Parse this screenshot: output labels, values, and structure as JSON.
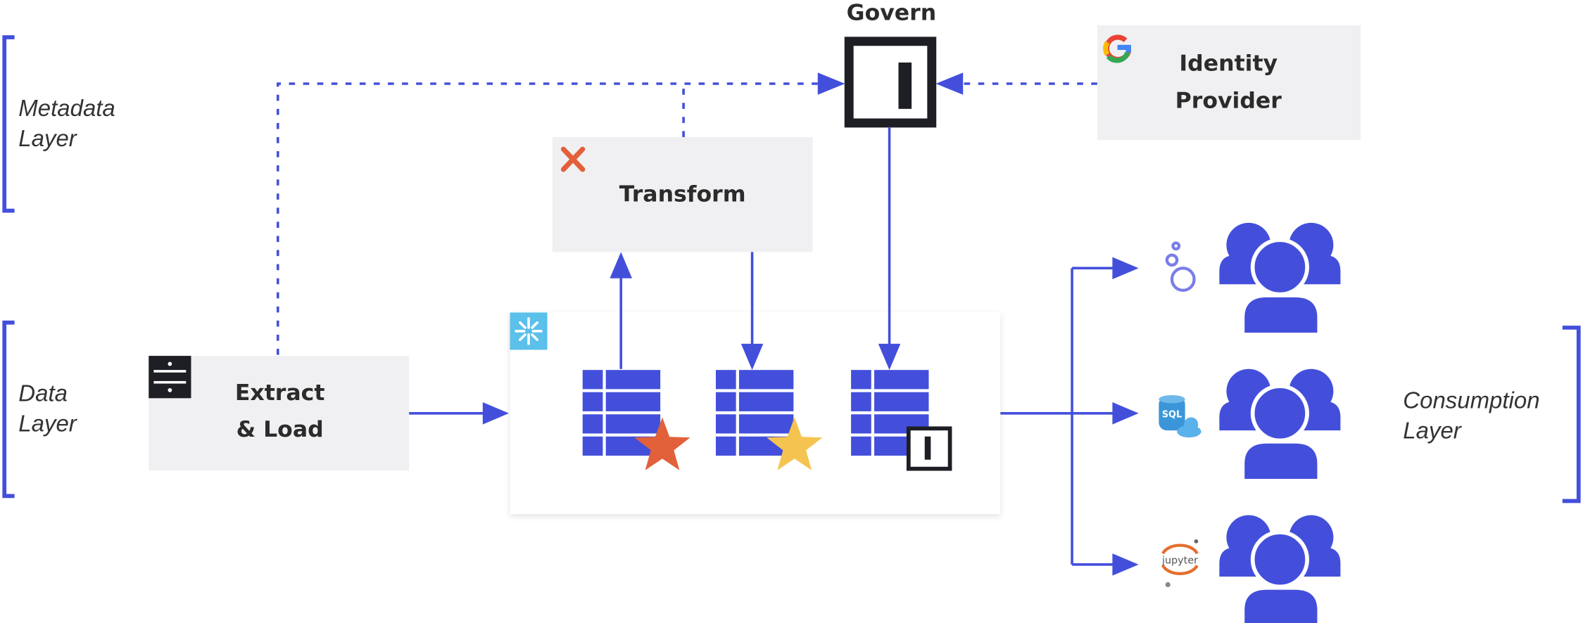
{
  "colors": {
    "accent": "#434fdb",
    "box": "#f0f0f2",
    "orange_star": "#e2603a",
    "yellow_star": "#f5c450",
    "snowflake": "#5bc0ea",
    "govern": "#1e1f24"
  },
  "layers": {
    "metadata": [
      "Metadata",
      "Layer"
    ],
    "data": [
      "Data",
      "Layer"
    ],
    "consumption": [
      "Consumption",
      "Layer"
    ]
  },
  "nodes": {
    "govern": {
      "label": "Govern"
    },
    "identity": {
      "label": [
        "Identity",
        "Provider"
      ],
      "icon": "google-icon"
    },
    "transform": {
      "label": "Transform",
      "icon": "dbt-icon"
    },
    "extract": {
      "label": [
        "Extract",
        "& Load"
      ],
      "icon": "fivetran-icon"
    },
    "warehouse": {
      "icon": "snowflake-icon"
    }
  },
  "consumers": [
    {
      "tool_icon": "looker-icon"
    },
    {
      "tool_icon": "sql-cloud-icon",
      "tool_text": "SQL"
    },
    {
      "tool_icon": "jupyter-icon",
      "tool_text": "jupyter"
    }
  ]
}
